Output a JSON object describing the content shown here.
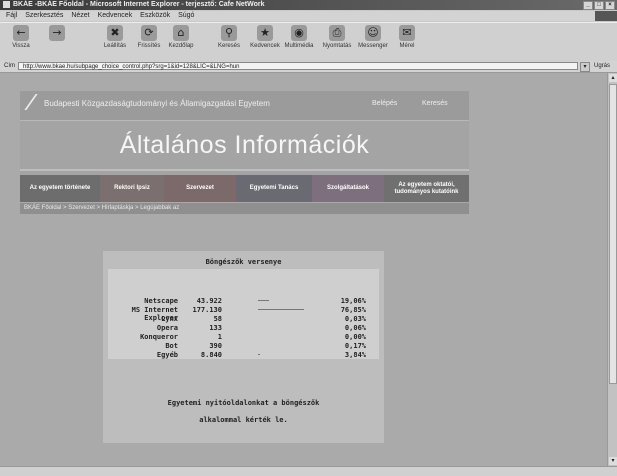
{
  "window": {
    "title": "BKÁE -BKÁE Főoldal - Microsoft Internet Explorer - terjesztő: Cafe NetWork"
  },
  "menu": [
    "Fájl",
    "Szerkesztés",
    "Nézet",
    "Kedvencek",
    "Eszközök",
    "Súgó"
  ],
  "toolbar": [
    {
      "label": "Vissza",
      "icon": "back-icon",
      "glyph": "←"
    },
    {
      "label": "",
      "icon": "forward-icon",
      "glyph": "→"
    },
    {
      "label": "Leállítás",
      "icon": "stop-icon",
      "glyph": "✖"
    },
    {
      "label": "Frissítés",
      "icon": "refresh-icon",
      "glyph": "⟳"
    },
    {
      "label": "Kezdőlap",
      "icon": "home-icon",
      "glyph": "⌂"
    },
    {
      "label": "Keresés",
      "icon": "search-icon",
      "glyph": "⚲"
    },
    {
      "label": "Kedvencek",
      "icon": "favorites-icon",
      "glyph": "★"
    },
    {
      "label": "Multimédia",
      "icon": "media-icon",
      "glyph": "◉"
    },
    {
      "label": "Nyomtatás",
      "icon": "print-icon",
      "glyph": "⎙"
    },
    {
      "label": "Messenger",
      "icon": "messenger-icon",
      "glyph": "☺"
    },
    {
      "label": "Mérel",
      "icon": "mail-icon",
      "glyph": "✉"
    }
  ],
  "address": {
    "label": "Cím",
    "url": "http://www.bkae.hu/subpage_choice_control.php?srg=1&id=128&LIC=&LNG=hun",
    "go": "Ugrás"
  },
  "site": {
    "university": "Budapesti Közgazdaságtudományi és Államigazgatási Egyetem",
    "link1": "Belépés",
    "link2": "Keresés",
    "banner_title": "Általános Információk",
    "nav": [
      {
        "label": "Az egyetem története",
        "color": "#6d6d6d"
      },
      {
        "label": "Rektori Ipsiz",
        "color": "#7b6f6f"
      },
      {
        "label": "Szervezet",
        "color": "#7c6a6a"
      },
      {
        "label": "Egyetemi Tanács",
        "color": "#6a6a72"
      },
      {
        "label": "Szolgáltatások",
        "color": "#7d6f7d"
      },
      {
        "label": "Az egyetem oktatói, tudományos kutatóink",
        "color": "#707070"
      }
    ],
    "breadcrumb": "BKÁE Főoldal > Szervezet > Hírlaptáskja > Legújabbak az"
  },
  "stats": {
    "title": "Böngészők versenye",
    "rows": [
      {
        "name": "Netscape",
        "count": "43.922",
        "pct": "19,06%",
        "fraction": 0.1906
      },
      {
        "name": "MS Internet Explorer",
        "count": "177.130",
        "pct": "76,85%",
        "fraction": 0.7685
      },
      {
        "name": "Lynx",
        "count": "58",
        "pct": "0,03%",
        "fraction": 0.0003
      },
      {
        "name": "Opera",
        "count": "133",
        "pct": "0,06%",
        "fraction": 0.0006
      },
      {
        "name": "Konqueror",
        "count": "1",
        "pct": "0,00%",
        "fraction": 0.0
      },
      {
        "name": "Bot",
        "count": "390",
        "pct": "0,17%",
        "fraction": 0.0017
      },
      {
        "name": "Egyéb",
        "count": "8.840",
        "pct": "3,84%",
        "fraction": 0.0384
      }
    ],
    "footer_line1": "Egyetemi nyitóoldalonkat a böngészők",
    "footer_line2": "alkalommal kérték le."
  }
}
